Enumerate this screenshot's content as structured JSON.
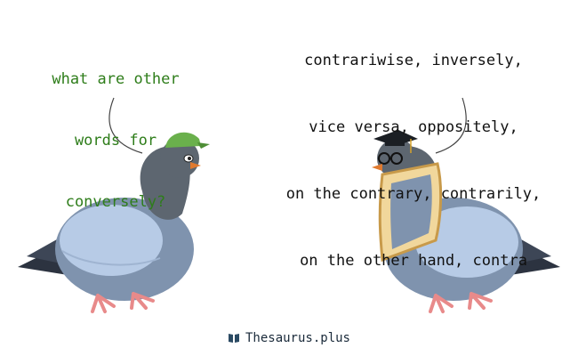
{
  "question": {
    "lines": [
      "what are other",
      "words for",
      "conversely?"
    ]
  },
  "answer": {
    "lines": [
      "contrariwise, inversely,",
      "vice versa, oppositely,",
      "on the contrary, contrarily,",
      "on the other hand, contra"
    ]
  },
  "footer": {
    "site_name": "Thesaurus.plus",
    "icon": "book-icon"
  },
  "colors": {
    "question_text": "#2e7d1a",
    "answer_text": "#111111",
    "pigeon_body": "#7f93ae",
    "pigeon_wing": "#b7cbe6",
    "pigeon_head": "#5d6670",
    "cap": "#6ab04c",
    "feet": "#e88a8a",
    "beak": "#e07a2f"
  }
}
